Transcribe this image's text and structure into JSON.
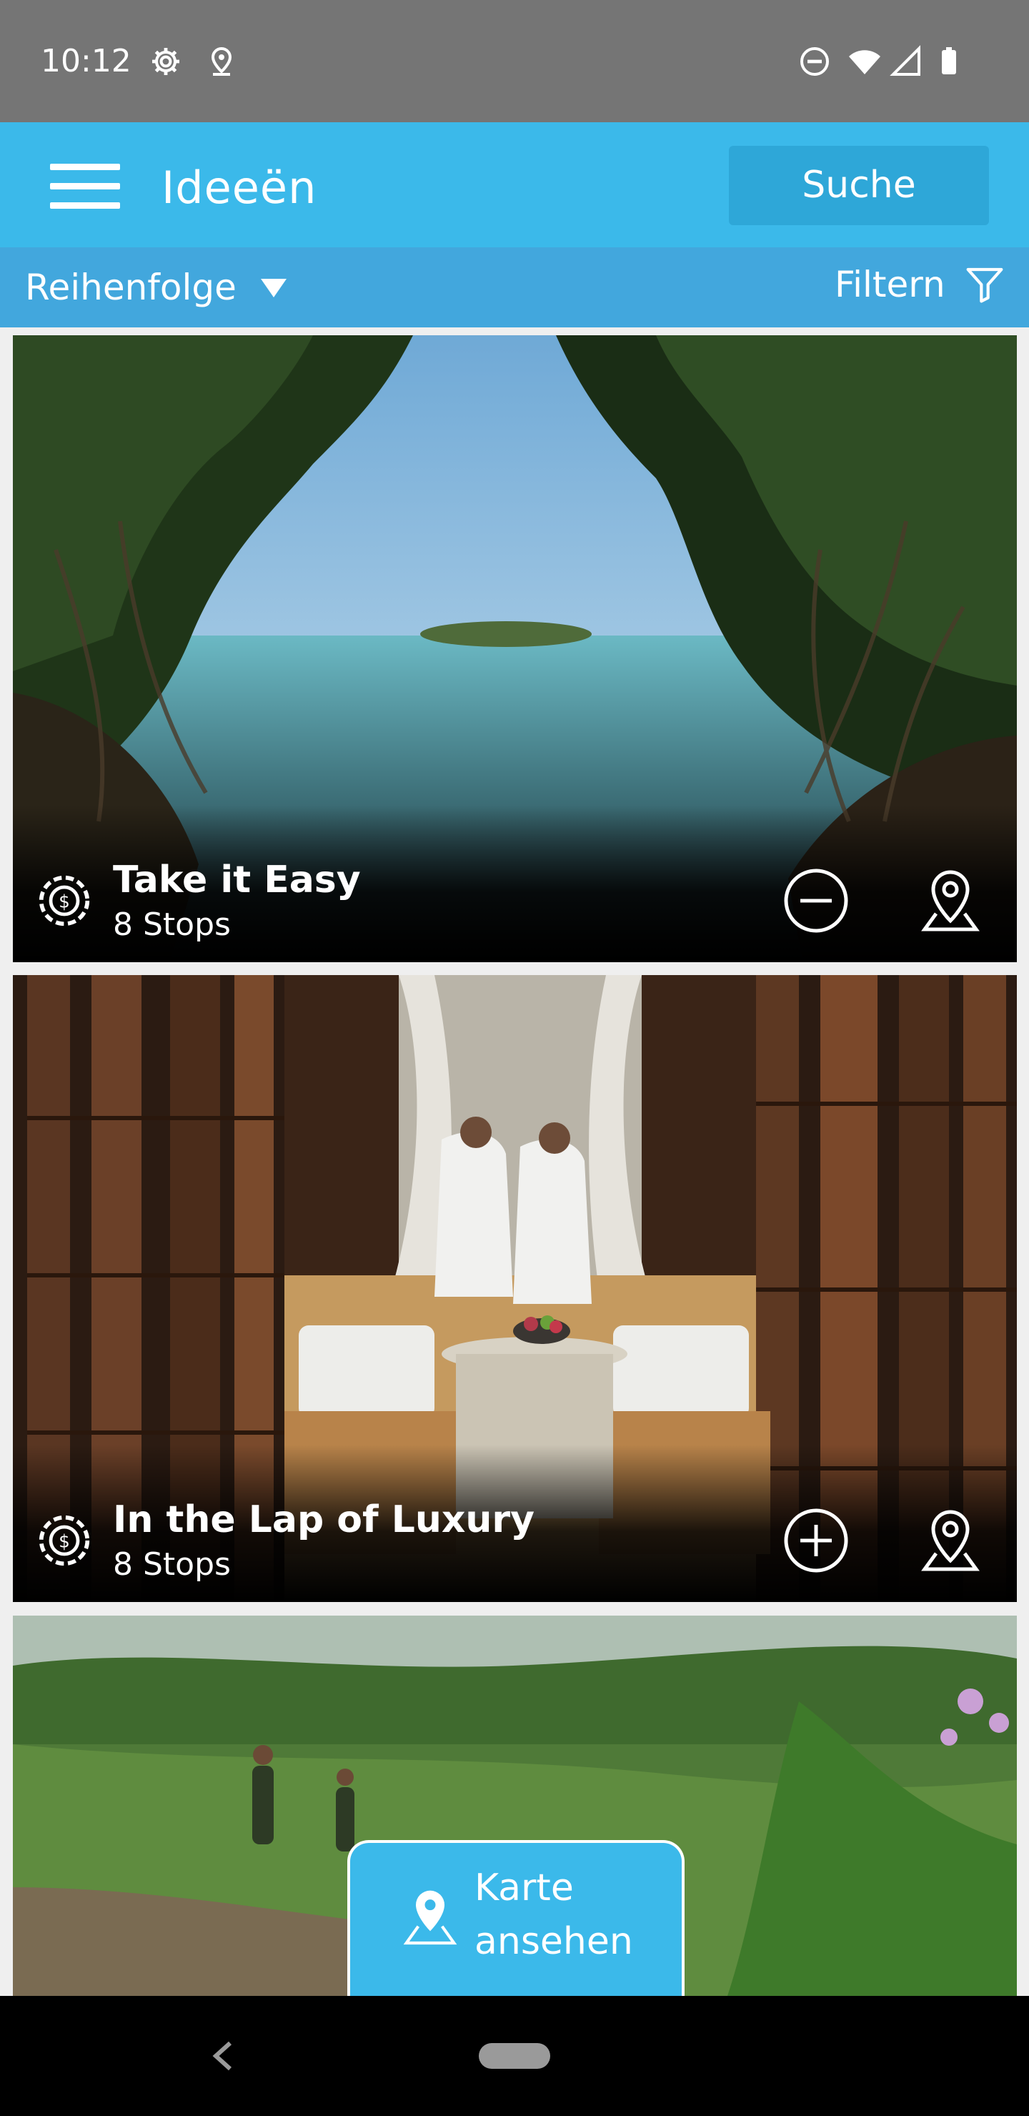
{
  "status_bar": {
    "time": "10:12",
    "icons": [
      "settings-icon",
      "location-icon",
      "do-not-disturb-icon",
      "wifi-icon",
      "signal-icon",
      "battery-icon"
    ]
  },
  "app_bar": {
    "title": "Ideeën",
    "search_label": "Suche",
    "menu_icon": "hamburger-menu-icon",
    "color": "#3bb9ea"
  },
  "sort_bar": {
    "sort_label": "Reihenfolge",
    "filter_label": "Filtern",
    "color": "#42a7dd"
  },
  "cards": [
    {
      "title": "Take it Easy",
      "subtitle": "8 Stops",
      "action_icon": "remove-circle-icon",
      "image": "mangrove beach scene"
    },
    {
      "title": "In the Lap of Luxury",
      "subtitle": "8 Stops",
      "action_icon": "add-circle-icon",
      "image": "bamboo spa couple"
    },
    {
      "title": "",
      "subtitle": "",
      "image": "hikers on green hillside"
    }
  ],
  "map_button": {
    "label": "Karte ansehen"
  }
}
